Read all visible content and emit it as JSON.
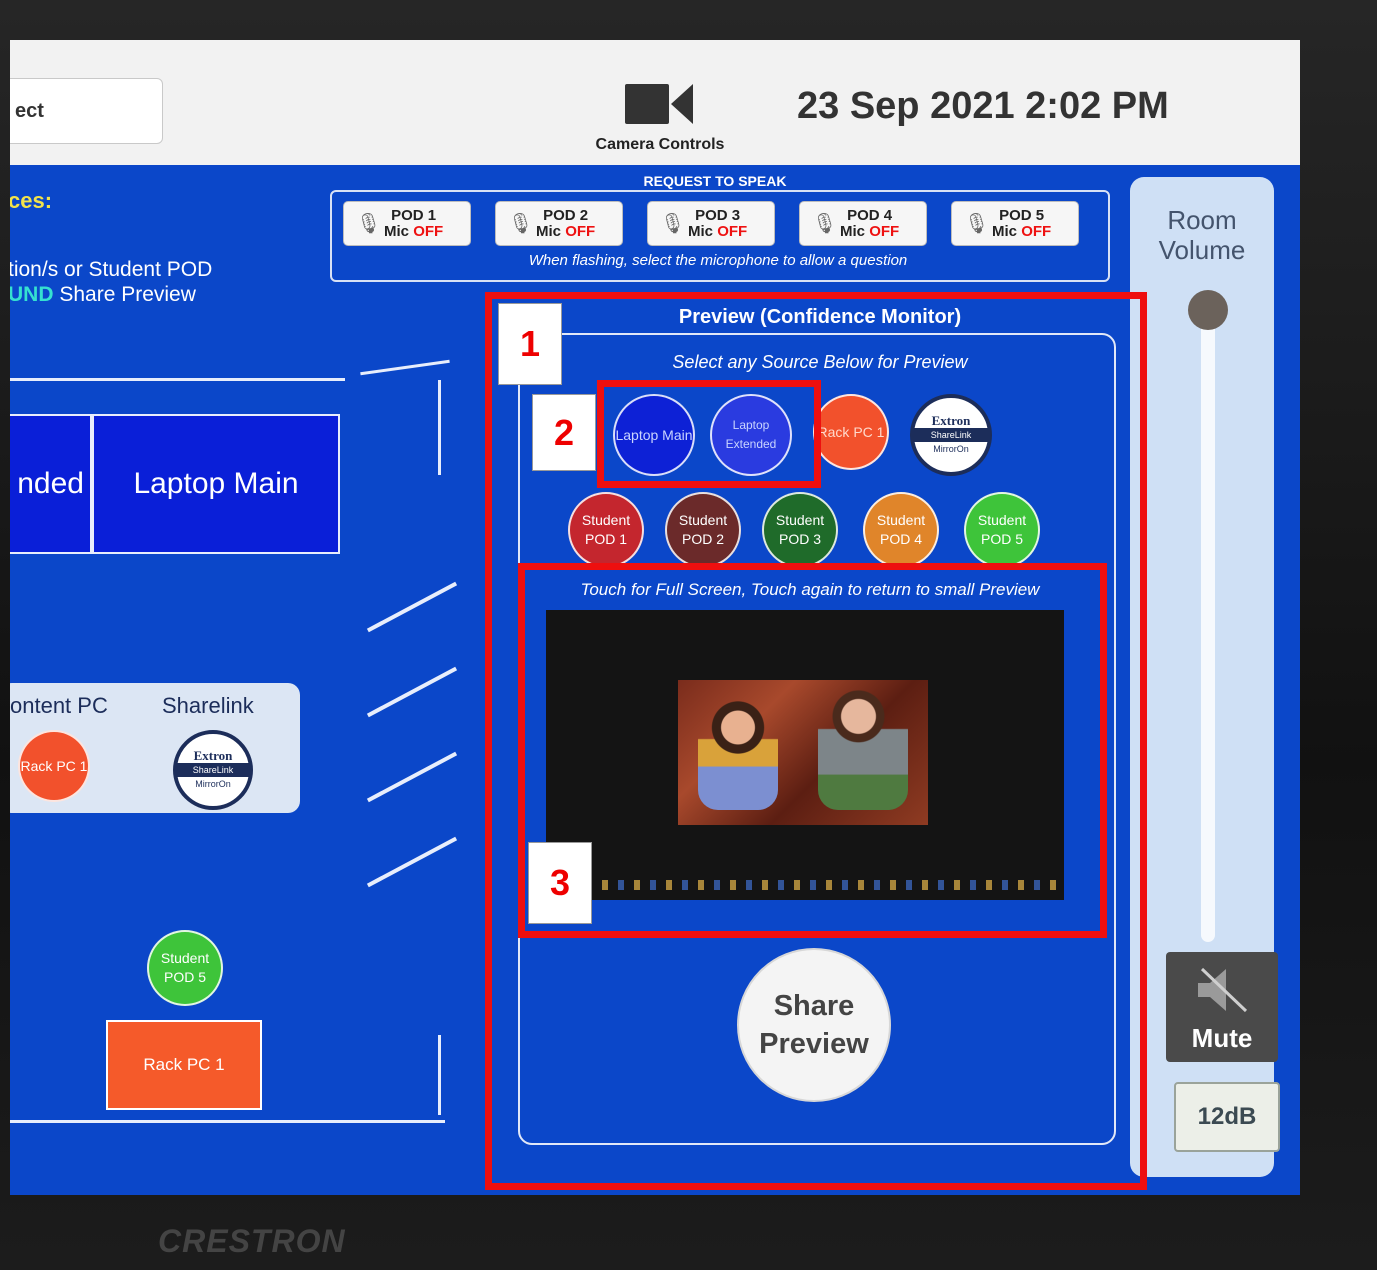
{
  "topbar": {
    "select_label": "ect",
    "camera_label": "Camera Controls",
    "datetime": "23 Sep 2021 2:02 PM"
  },
  "left": {
    "sources_title": "ces:",
    "instruction_line1": "tion/s or Student POD",
    "instruction_line2_highlight": "UND",
    "instruction_line2_rest": " Share Preview",
    "tile_extended": "nded",
    "tile_laptop_main": "Laptop Main",
    "group_label_content_pc": "ontent PC",
    "group_label_sharelink": "Sharelink",
    "rack_pc_circle": "Rack PC 1",
    "student_pod5_circle": "Student POD 5",
    "rack_pc_box": "Rack PC 1",
    "extron_top": "Extron",
    "extron_mid": "ShareLink",
    "extron_bottom": "MirrorOn"
  },
  "request_to_speak": {
    "title": "REQUEST TO SPEAK",
    "note": "When flashing, select the microphone to allow a question",
    "pods": [
      {
        "name": "POD 1",
        "mic": "Mic",
        "state": "OFF"
      },
      {
        "name": "POD 2",
        "mic": "Mic",
        "state": "OFF"
      },
      {
        "name": "POD 3",
        "mic": "Mic",
        "state": "OFF"
      },
      {
        "name": "POD 4",
        "mic": "Mic",
        "state": "OFF"
      },
      {
        "name": "POD 5",
        "mic": "Mic",
        "state": "OFF"
      }
    ]
  },
  "preview": {
    "title": "Preview (Confidence Monitor)",
    "subtitle": "Select any Source Below for Preview",
    "touch_note": "Touch for Full Screen, Touch again to return to small Preview",
    "share_button": "Share Preview",
    "sources_row1": [
      {
        "label": "Laptop Main",
        "color": "#0d21d6"
      },
      {
        "label": "Laptop Extended",
        "color": "#2a3be0"
      },
      {
        "label": "Rack PC 1",
        "color": "#f2512c"
      },
      {
        "label": "Extron ShareLink MirrorOn",
        "color": "#ffffff"
      }
    ],
    "sources_row2": [
      {
        "label": "Student POD 1",
        "color": "#c4262e"
      },
      {
        "label": "Student POD 2",
        "color": "#6b2a2a"
      },
      {
        "label": "Student POD 3",
        "color": "#1f6b2a"
      },
      {
        "label": "Student POD 4",
        "color": "#e0852a"
      },
      {
        "label": "Student POD 5",
        "color": "#3ec43a"
      }
    ]
  },
  "volume": {
    "label": "Room Volume",
    "level": 1.0,
    "mute_label": "Mute",
    "db_value": "12dB"
  },
  "brand": "CRESTRON",
  "annotations": [
    "1",
    "2",
    "3"
  ],
  "colors": {
    "screen_bg": "#0b47c9",
    "annotation_red": "#ee0f0f",
    "mic_off_red": "#e11111"
  }
}
